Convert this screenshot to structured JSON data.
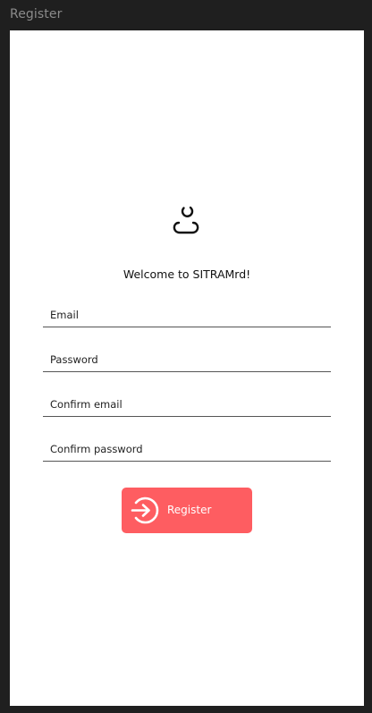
{
  "window": {
    "title": "Register"
  },
  "welcome": {
    "text": "Welcome to SITRAMrd!"
  },
  "form": {
    "email_label": "Email",
    "password_label": "Password",
    "confirm_email_label": "Confirm email",
    "confirm_password_label": "Confirm password"
  },
  "register_button": {
    "label": "Register",
    "icon": "login-arrow-circle-icon",
    "color": "#fe5d61"
  },
  "logo": {
    "icon": "person-outline-icon"
  }
}
